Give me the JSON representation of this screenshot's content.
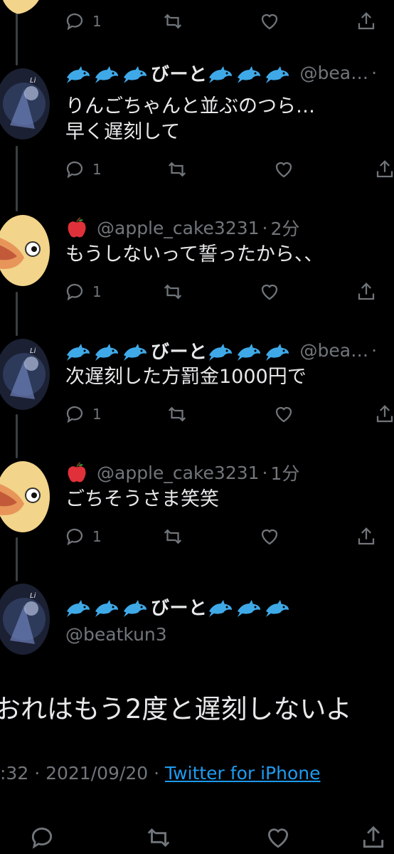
{
  "colors": {
    "background": "#000000",
    "text": "#e7e9ea",
    "muted": "#71767b",
    "link": "#1d9bf0",
    "thread_line": "#3a3f44"
  },
  "tweets": [
    {
      "actions": {
        "reply_count": "1",
        "icons": [
          "reply-icon",
          "retweet-icon",
          "like-icon",
          "share-icon"
        ]
      }
    },
    {
      "name": "🐬🐬🐬びーと🐬🐬🐬",
      "name_text": "びーと",
      "handle": "@bea…",
      "sep": "·",
      "lines": [
        "りんごちゃんと並ぶのつら…",
        "早く遅刻して"
      ],
      "actions": {
        "reply_count": "1"
      }
    },
    {
      "name_prefix_icon": "apple-emoji",
      "handle": "@apple_cake3231",
      "sep": "·",
      "time": "2分",
      "lines": [
        "もうしないって誓ったから、、"
      ],
      "actions": {
        "reply_count": "1"
      }
    },
    {
      "name": "🐬🐬🐬びーと🐬🐬🐬",
      "name_text": "びーと",
      "handle": "@bea…",
      "sep": "·",
      "lines": [
        "次遅刻した方罰金1000円で"
      ],
      "actions": {
        "reply_count": "1"
      }
    },
    {
      "name_prefix_icon": "apple-emoji",
      "handle": "@apple_cake3231",
      "sep": "·",
      "time": "1分",
      "lines": [
        "ごちそうさま笑笑"
      ],
      "actions": {
        "reply_count": "1"
      }
    }
  ],
  "main_tweet": {
    "name": "🐬🐬🐬びーと🐬🐬🐬",
    "name_text": "びーと",
    "handle": "@beatkun3",
    "text": "おれはもう2度と遅刻しないよ",
    "time_partial": ":32",
    "sep": "·",
    "date": "2021/09/20",
    "source": "Twitter for iPhone"
  }
}
